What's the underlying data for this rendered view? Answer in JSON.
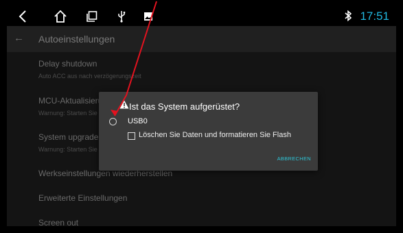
{
  "statusbar": {
    "icons": [
      "back-chevron-icon",
      "home-icon",
      "recent-apps-icon",
      "usb-icon",
      "image-icon"
    ],
    "bluetooth_icon": "bluetooth-icon",
    "time": "17:51",
    "time_color": "#21b8e0"
  },
  "appbar": {
    "back_icon": "←",
    "title": "Autoeinstellungen"
  },
  "settings": {
    "items": [
      {
        "title": "Delay shutdown",
        "subtitle": "Auto ACC aus nach verzögerungszeit"
      },
      {
        "title": "MCU-Aktualisierung",
        "subtitle": "Warnung: Starten Sie de"
      },
      {
        "title": "System upgrade",
        "subtitle": "Warnung: Starten Sie de"
      },
      {
        "title": "Werkseinstellungen wiederherstellen",
        "subtitle": ""
      },
      {
        "title": "Erweiterte Einstellungen",
        "subtitle": ""
      },
      {
        "title": "Screen out",
        "subtitle": ""
      }
    ]
  },
  "dialog": {
    "title": "Ist das System aufgerüstet?",
    "option_usb": "USB0",
    "checkbox_label": "Löschen Sie Daten und formatieren Sie Flash",
    "cancel_label": "ABBRECHEN",
    "accent_color": "#2ec4d6"
  }
}
